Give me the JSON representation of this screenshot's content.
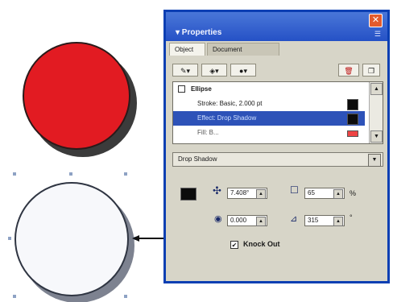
{
  "panel": {
    "title": "▾ Properties",
    "close_glyph": "✕",
    "gripper": "☰",
    "tabs": [
      "Object",
      "Document"
    ]
  },
  "toolbar": {
    "buttons": [
      {
        "icon": "pen-icon",
        "glyph": "✎▾"
      },
      {
        "icon": "bucket-icon",
        "glyph": "◈▾"
      },
      {
        "icon": "effects-icon",
        "glyph": "●▾"
      },
      {
        "icon": "trash-icon",
        "glyph": "🗑"
      },
      {
        "icon": "copy-icon",
        "glyph": "❐"
      }
    ]
  },
  "attributes": {
    "object_name": "Ellipse",
    "stroke_label": "Stroke: Basic, 2.000 pt",
    "effect_label": "Effect: Drop Shadow",
    "partial_row": "Fill: B..."
  },
  "effect_dropdown": {
    "selected": "Drop Shadow",
    "arrow": "▼"
  },
  "shadow": {
    "angle": "7.408°",
    "distance": "0.000",
    "opacity": "65",
    "opacity_unit": "%",
    "softness": "315",
    "softness_unit": "°",
    "knock_out_label": "Knock Out",
    "knock_out_checked": true,
    "check_glyph": "✔"
  },
  "colors": {
    "red_circle": "#e21b22",
    "title_bar": "#2551c6",
    "selection": "#2d52b8",
    "shadow_color": "#0c0c0c"
  }
}
